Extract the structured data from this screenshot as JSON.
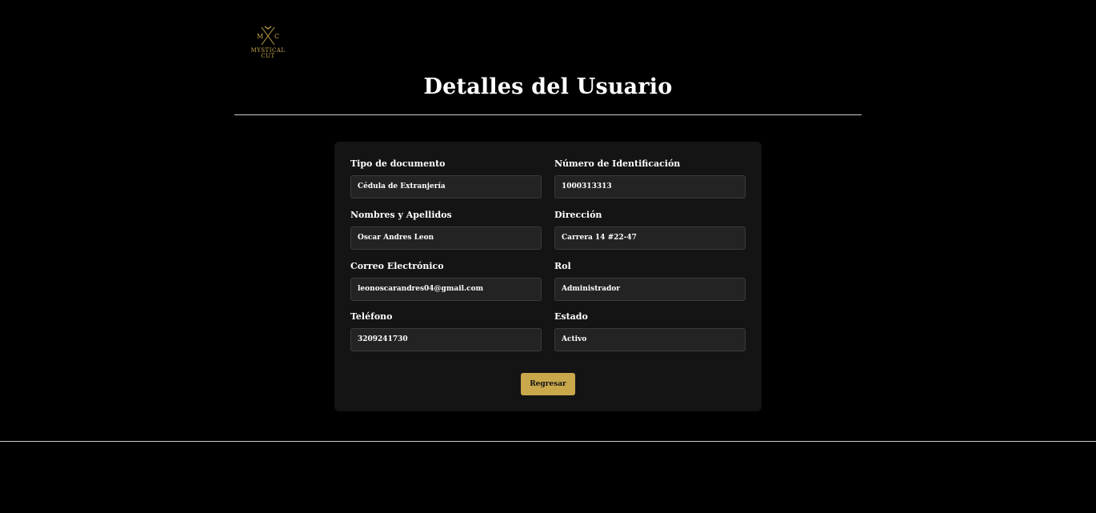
{
  "brand": {
    "monogram_left": "M",
    "monogram_right": "C",
    "name_line1": "MYSTICAL",
    "name_line2": "CUT",
    "accent_color": "#c9a84c"
  },
  "page": {
    "title": "Detalles del Usuario"
  },
  "form": {
    "document_type": {
      "label": "Tipo de documento",
      "value": "Cédula de Extranjería"
    },
    "id_number": {
      "label": "Número de Identificación",
      "value": "1000313313"
    },
    "full_name": {
      "label": "Nombres y Apellidos",
      "value": "Oscar Andres Leon"
    },
    "address": {
      "label": "Dirección",
      "value": "Carrera 14 #22-47"
    },
    "email": {
      "label": "Correo Electrónico",
      "value": "leonoscarandres04@gmail.com"
    },
    "role": {
      "label": "Rol",
      "value": "Administrador"
    },
    "phone": {
      "label": "Teléfono",
      "value": "3209241730"
    },
    "status": {
      "label": "Estado",
      "value": "Activo"
    }
  },
  "actions": {
    "back_label": "Regresar"
  }
}
